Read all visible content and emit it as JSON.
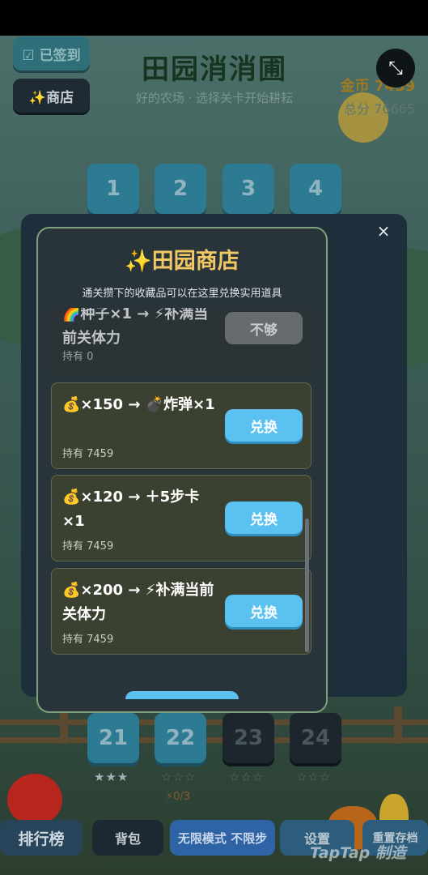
{
  "header": {
    "signed_in": "☑ 已签到",
    "shop": "✨商店",
    "title": "田园消消圃",
    "subtitle": "好的农场 · 选择关卡开始耕耘",
    "coins": "金币 7459",
    "score": "总分 76665"
  },
  "levels_top": [
    "1",
    "2",
    "3",
    "4"
  ],
  "levels_bottom": [
    {
      "label": "21",
      "stars": "★★★",
      "state": "open"
    },
    {
      "label": "22",
      "stars": "☆☆☆",
      "state": "open"
    },
    {
      "label": "23",
      "stars": "☆☆☆",
      "state": "locked"
    },
    {
      "label": "24",
      "stars": "☆☆☆",
      "state": "locked"
    }
  ],
  "level22_energy": "⚡0/3",
  "bottom_nav": {
    "rank": "排行榜",
    "bag": "背包",
    "endless": "无限模式 不限步",
    "settings": "设置",
    "reset": "重置存档"
  },
  "watermark": "TapTap 制造",
  "shop": {
    "title": "✨田园商店",
    "description": "通关攒下的收藏品可以在这里兑换实用道具",
    "close_label": "×",
    "items": [
      {
        "text": "🌈种子×1 → ⚡补满当前关体力",
        "hold": "持有 0",
        "button": "不够",
        "enabled": false
      },
      {
        "text": "💰×150 → 💣炸弹×1",
        "hold": "持有 7459",
        "button": "兑换",
        "enabled": true
      },
      {
        "text": "💰×120 → ＋5步卡×1",
        "hold": "持有 7459",
        "button": "兑换",
        "enabled": true
      },
      {
        "text": "💰×200 → ⚡补满当前关体力",
        "hold": "持有 7459",
        "button": "兑换",
        "enabled": true
      }
    ]
  },
  "colors": {
    "accent_button": "#5ac1f0",
    "title_gold": "#f0c764",
    "modal_bg": "#1d2f3b"
  }
}
